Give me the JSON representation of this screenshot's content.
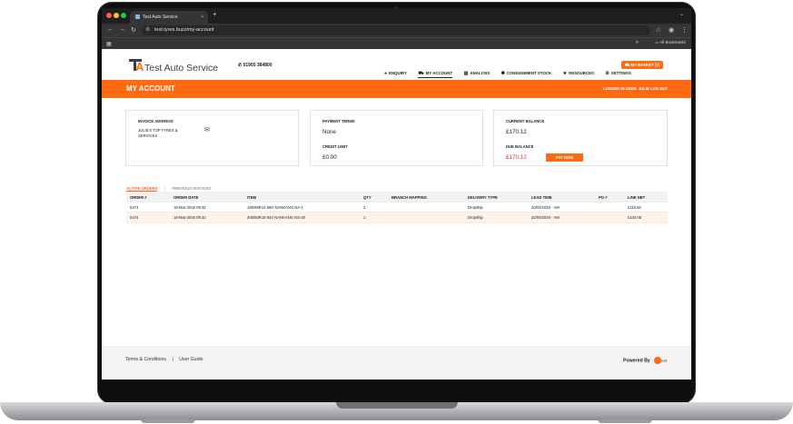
{
  "browser": {
    "tab_title": "Test Auto Service",
    "tab_close": "×",
    "new_tab": "+",
    "url": "test.tyres.buzz/my-account",
    "bookmarks_all": "All Bookmarks"
  },
  "header": {
    "logo_letters": "TA",
    "brand": "Test Auto Service",
    "phone": "01905 384800",
    "nav": [
      {
        "label": "Enquiry",
        "icon": "chat-icon"
      },
      {
        "label": "My Account",
        "icon": "cart-icon",
        "active": true
      },
      {
        "label": "Analysis",
        "icon": "chart-icon"
      },
      {
        "label": "Consignment Stock",
        "icon": "gear-icon"
      },
      {
        "label": "Resources",
        "icon": "star-icon"
      },
      {
        "label": "Settings",
        "icon": "settings-icon"
      }
    ],
    "basket": "MY BASKET (0)"
  },
  "banner": {
    "title": "MY ACCOUNT",
    "logged_in": "LOGGED IN USER: Julie",
    "logout": "LOG OUT"
  },
  "invoice": {
    "label": "INVOICE ADDRESS",
    "address": "JULIE'S TOP TYRES & SERVICES"
  },
  "payment": {
    "terms_label": "PAYMENT TERMS",
    "terms_value": "None",
    "credit_label": "CREDIT LIMIT",
    "credit_value": "£0.00"
  },
  "balance": {
    "current_label": "CURRENT BALANCE",
    "current_value": "£170.12",
    "due_label": "DUE BALANCE",
    "due_value": "£170.12",
    "pay_now": "PAY NOW"
  },
  "order_tabs": {
    "active": "ACTIVE ORDERS",
    "separator": "|",
    "previous": "PREVIOUS INVOICES"
  },
  "orders": {
    "columns": [
      "ORDER #",
      "ORDER DATE",
      "ITEM",
      "QTY",
      "BRANCH MAPPING",
      "DELIVERY TYPE",
      "LEAD TIME",
      "PO #",
      "LINE NET"
    ],
    "rows": [
      [
        "5474",
        "18-Mar-2026 09:32",
        "185/65R14 86H NANKANG NA-1",
        "2",
        "",
        "Dropship",
        "20/03/2026 - AM",
        "",
        "£115.50"
      ],
      [
        "5474",
        "18-Mar-2026 09:32",
        "205/55R16 94V NANKANG NS-20",
        "1",
        "",
        "Dropship",
        "20/03/2026 - AM",
        "",
        "£103.05"
      ]
    ]
  },
  "footer": {
    "terms": "Terms & Conditions",
    "separator": "|",
    "guide": "User Guide",
    "powered": "Powered By",
    "powered_logo": "net"
  },
  "colors": {
    "accent": "#ff6a13",
    "due": "#e12a2a"
  }
}
